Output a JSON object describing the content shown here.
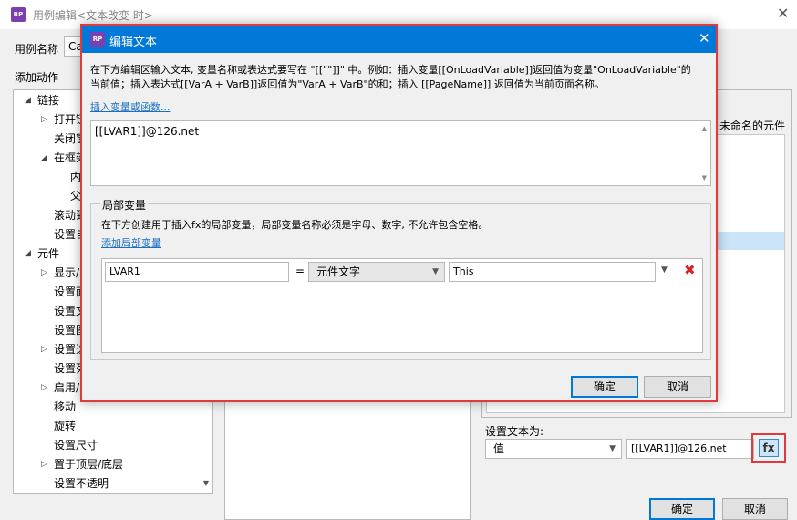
{
  "outer": {
    "title": "用例编辑<文本改变 时>",
    "case_name_label": "用例名称",
    "case_name_value": "Ca",
    "add_action_label": "添加动作",
    "tree": [
      {
        "label": "链接",
        "indent": 0,
        "arrow": "expanded"
      },
      {
        "label": "打开链",
        "indent": 1,
        "arrow": "collapsed"
      },
      {
        "label": "关闭窗",
        "indent": 1,
        "arrow": "none"
      },
      {
        "label": "在框架",
        "indent": 1,
        "arrow": "expanded"
      },
      {
        "label": "内",
        "indent": 2,
        "arrow": "none"
      },
      {
        "label": "父",
        "indent": 2,
        "arrow": "none"
      },
      {
        "label": "滚动到",
        "indent": 1,
        "arrow": "none"
      },
      {
        "label": "设置自",
        "indent": 1,
        "arrow": "none"
      },
      {
        "label": "元件",
        "indent": 0,
        "arrow": "expanded"
      },
      {
        "label": "显示/",
        "indent": 1,
        "arrow": "collapsed"
      },
      {
        "label": "设置面",
        "indent": 1,
        "arrow": "none"
      },
      {
        "label": "设置文",
        "indent": 1,
        "arrow": "none"
      },
      {
        "label": "设置图",
        "indent": 1,
        "arrow": "none"
      },
      {
        "label": "设置选",
        "indent": 1,
        "arrow": "collapsed"
      },
      {
        "label": "设置列",
        "indent": 1,
        "arrow": "none"
      },
      {
        "label": "启用/",
        "indent": 1,
        "arrow": "collapsed"
      },
      {
        "label": "移动",
        "indent": 1,
        "arrow": "none"
      },
      {
        "label": "旋转",
        "indent": 1,
        "arrow": "none"
      },
      {
        "label": "设置尺寸",
        "indent": 1,
        "arrow": "none"
      },
      {
        "label": "置于顶层/底层",
        "indent": 1,
        "arrow": "collapsed"
      },
      {
        "label": "设置不透明",
        "indent": 1,
        "arrow": "none"
      }
    ],
    "right_panel_header": "未命名的元件",
    "set_text_label": "设置文本为:",
    "value_type_selected": "值",
    "value_text": "[[LVAR1]]@126.net",
    "fx_label": "fx",
    "ok_label": "确定",
    "cancel_label": "取消"
  },
  "dialog": {
    "title": "编辑文本",
    "icon_label": "RP",
    "description_line1": "在下方编辑区输入文本, 变量名称或表达式要写在 \"[[\"\"]]\" 中。例如：插入变量[[OnLoadVariable]]返回值为变量\"OnLoadVariable\"的",
    "description_line2": "当前值；插入表达式[[VarA + VarB]]返回值为\"VarA + VarB\"的和；插入 [[PageName]] 返回值为当前页面名称。",
    "insert_link": "插入变量或函数...",
    "editor_text": "[[LVAR1]]@126.net",
    "local_vars_title": "局部变量",
    "local_vars_desc": "在下方创建用于插入fx的局部变量，局部变量名称必须是字母、数字, 不允许包含空格。",
    "add_local_var_link": "添加局部变量",
    "variable_row": {
      "name": "LVAR1",
      "equals": "=",
      "type": "元件文字",
      "target": "This"
    },
    "ok_label": "确定",
    "cancel_label": "取消"
  },
  "colors": {
    "accent": "#0078d7",
    "highlight_border": "#e0393e",
    "delete": "#e02020",
    "link": "#1a6fc4"
  }
}
